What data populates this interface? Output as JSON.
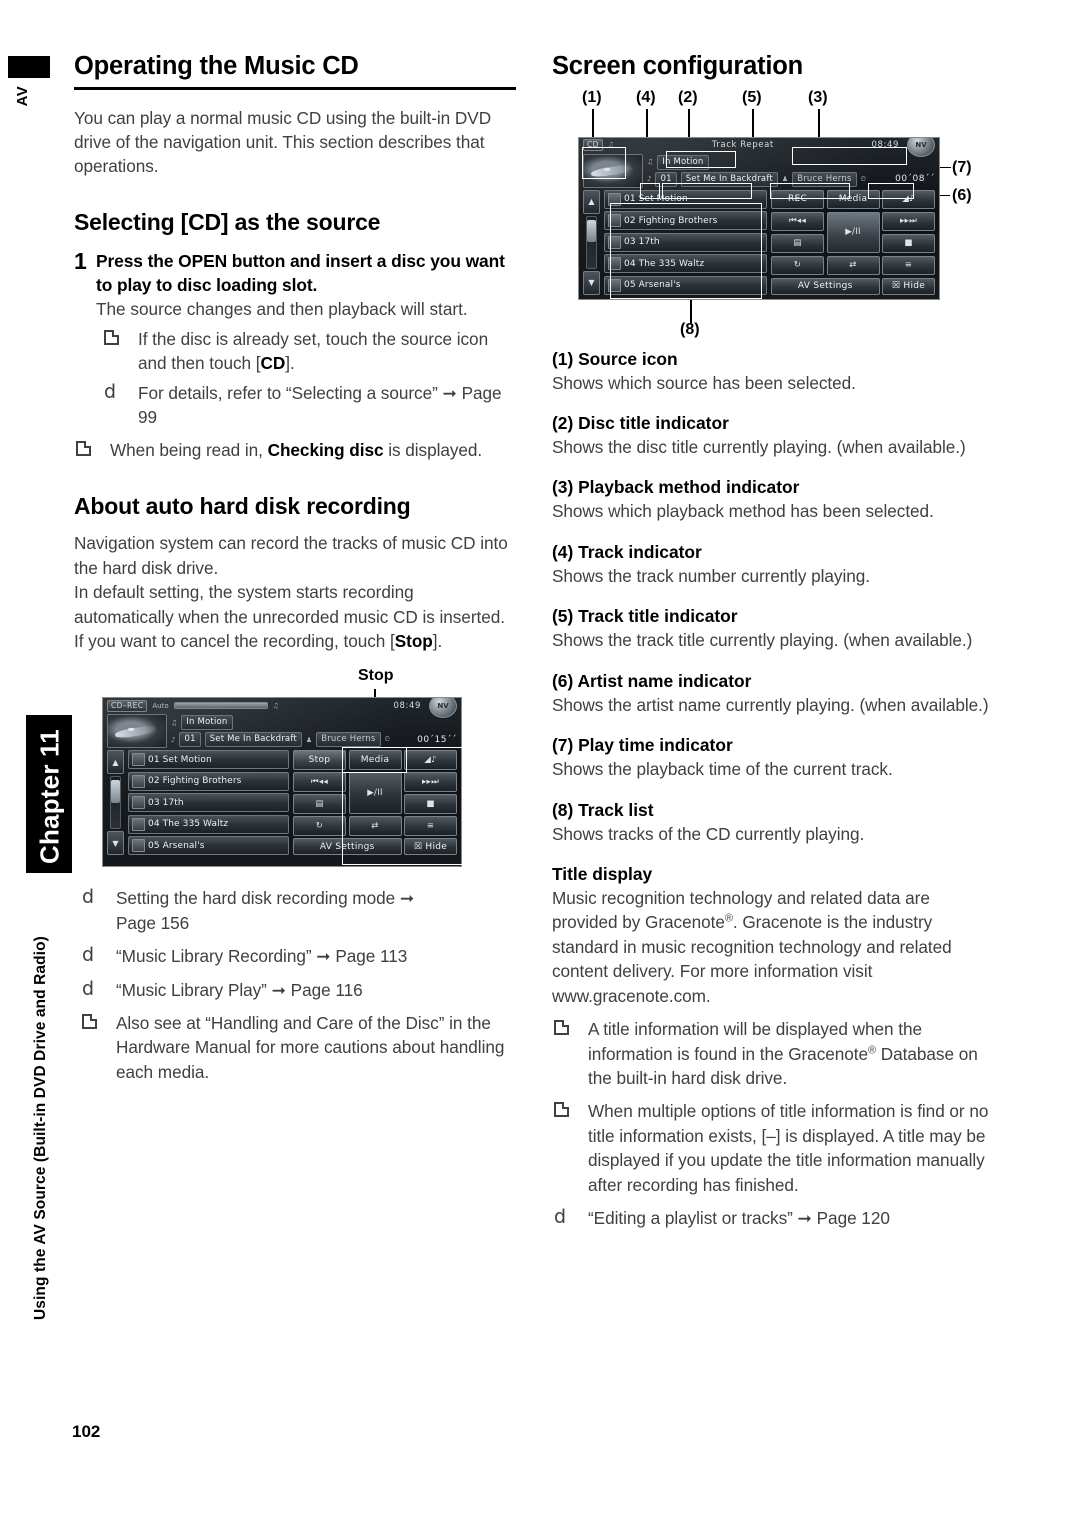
{
  "sidebar": {
    "av_label": "AV",
    "chapter_label": "Chapter 11",
    "running_head": "Using the AV Source (Built-in DVD Drive and Radio)"
  },
  "page_number": "102",
  "left_column": {
    "title": "Operating the Music CD",
    "intro": "You can play a normal music CD using the built-in DVD drive of the navigation unit. This section describes that operations.",
    "selecting_heading": "Selecting [CD] as the source",
    "step_number": "1",
    "step_heading": "Press the OPEN button and insert a disc you want to play to disc loading slot.",
    "step_heading_bold_word": "OPEN",
    "step_sub": "The source changes and then playback will start.",
    "note_disc_set": "If the disc is already set, touch the source icon and then touch [CD].",
    "note_disc_set_bold": "CD",
    "ref_selecting_source_text": "For details, refer to “Selecting a source”",
    "ref_selecting_source_page": "Page 99",
    "note_checking_disc_a": "When being read in, ",
    "note_checking_disc_bold": "Checking disc",
    "note_checking_disc_b": " is displayed.",
    "hdd_heading": "About auto hard disk recording",
    "hdd_p1": "Navigation system can record the tracks of music CD into the hard disk drive.",
    "hdd_p2": "In default setting, the system starts recording automatically when the unrecorded music CD is inserted.",
    "hdd_p3_a": "If you want to cancel the recording, touch [",
    "hdd_p3_bold": "Stop",
    "hdd_p3_b": "].",
    "stop_callout_label": "Stop",
    "ref_hdd_mode_text": "Setting the hard disk recording mode",
    "ref_hdd_mode_page": "Page 156",
    "ref_music_lib_rec_text": "“Music Library Recording”",
    "ref_music_lib_rec_page": "Page 113",
    "ref_music_lib_play_text": "“Music Library Play”",
    "ref_music_lib_play_page": "Page 116",
    "note_handling": "Also see at “Handling and Care of the Disc” in the Hardware Manual for more cautions about handling each media."
  },
  "right_column": {
    "title": "Screen configuration",
    "callouts": [
      "(1)",
      "(4)",
      "(2)",
      "(5)",
      "(3)",
      "(7)",
      "(6)",
      "(8)"
    ],
    "definitions": [
      {
        "head": "(1) Source icon",
        "body": "Shows which source has been selected."
      },
      {
        "head": "(2) Disc title indicator",
        "body": "Shows the disc title currently playing. (when available.)"
      },
      {
        "head": "(3) Playback method indicator",
        "body": "Shows which playback method has been selected."
      },
      {
        "head": "(4) Track indicator",
        "body": "Shows the track number currently playing."
      },
      {
        "head": "(5) Track title indicator",
        "body": "Shows the track title currently playing. (when available.)"
      },
      {
        "head": "(6) Artist name indicator",
        "body": "Shows the artist name currently playing. (when available.)"
      },
      {
        "head": "(7) Play time indicator",
        "body": "Shows the playback time of the current track."
      },
      {
        "head": "(8) Track list",
        "body": "Shows tracks of the CD currently playing."
      }
    ],
    "title_display_head": "Title display",
    "title_display_body_a": "Music recognition technology and related data are provided by Gracenote",
    "title_display_body_b": ". Gracenote is the industry standard in music recognition technology and related content delivery. For more information visit www.gracenote.com.",
    "note_title_info_a": "A title information will be displayed when the information is found in the Gracenote",
    "note_title_info_b": " Database on the built-in hard disk drive.",
    "note_multiple_options": "When multiple options of title information is find or no title information exists, [–] is displayed. A title may be displayed if you update the title information manually after recording has finished.",
    "ref_editing_text": "“Editing a playlist or tracks”",
    "ref_editing_page": "Page 120"
  },
  "screenshot_config": {
    "source_tag": "CD",
    "clock": "08:49",
    "globe_label": "NV",
    "playback_method": "Track   Repeat",
    "disc_title": "In Motion",
    "track_number": "01",
    "track_title": "Set Me In Backdraft",
    "artist_name": "Bruce Herns",
    "play_time": "00´08´´",
    "tracks": [
      "01 Set Motion",
      "02 Fighting Brothers",
      "03 17th",
      "04 The 335 Waltz",
      "05 Arsenal's"
    ],
    "buttons": {
      "rec": "REC",
      "media": "Media",
      "eq": "◢♪",
      "prev": "⏮◂◂",
      "play_pause": "▶/II",
      "next": "▸▸⏭",
      "disc": "▤",
      "stop_square": "■",
      "repeat": "↻",
      "shuffle": "⇄",
      "list": "≡",
      "av_settings": "AV Settings",
      "hide": "☒ Hide"
    }
  },
  "screenshot_stop": {
    "source_tag": "CD–REC",
    "auto_label": "Auto",
    "clock": "08:49",
    "globe_label": "NV",
    "disc_title": "In Motion",
    "track_number": "01",
    "track_title": "Set Me In Backdraft",
    "artist_name": "Bruce Herns",
    "play_time": "00´15´´",
    "tracks": [
      "01 Set Motion",
      "02 Fighting Brothers",
      "03 17th",
      "04 The 335 Waltz",
      "05 Arsenal's"
    ],
    "buttons": {
      "stop": "Stop",
      "media": "Media",
      "eq": "◢♪",
      "prev": "⏮◂◂",
      "play_pause": "▶/II",
      "next": "▸▸⏭",
      "disc": "▤",
      "stop_square": "■",
      "repeat": "↻",
      "shuffle": "⇄",
      "list": "≡",
      "av_settings": "AV Settings",
      "hide": "☒ Hide"
    }
  }
}
